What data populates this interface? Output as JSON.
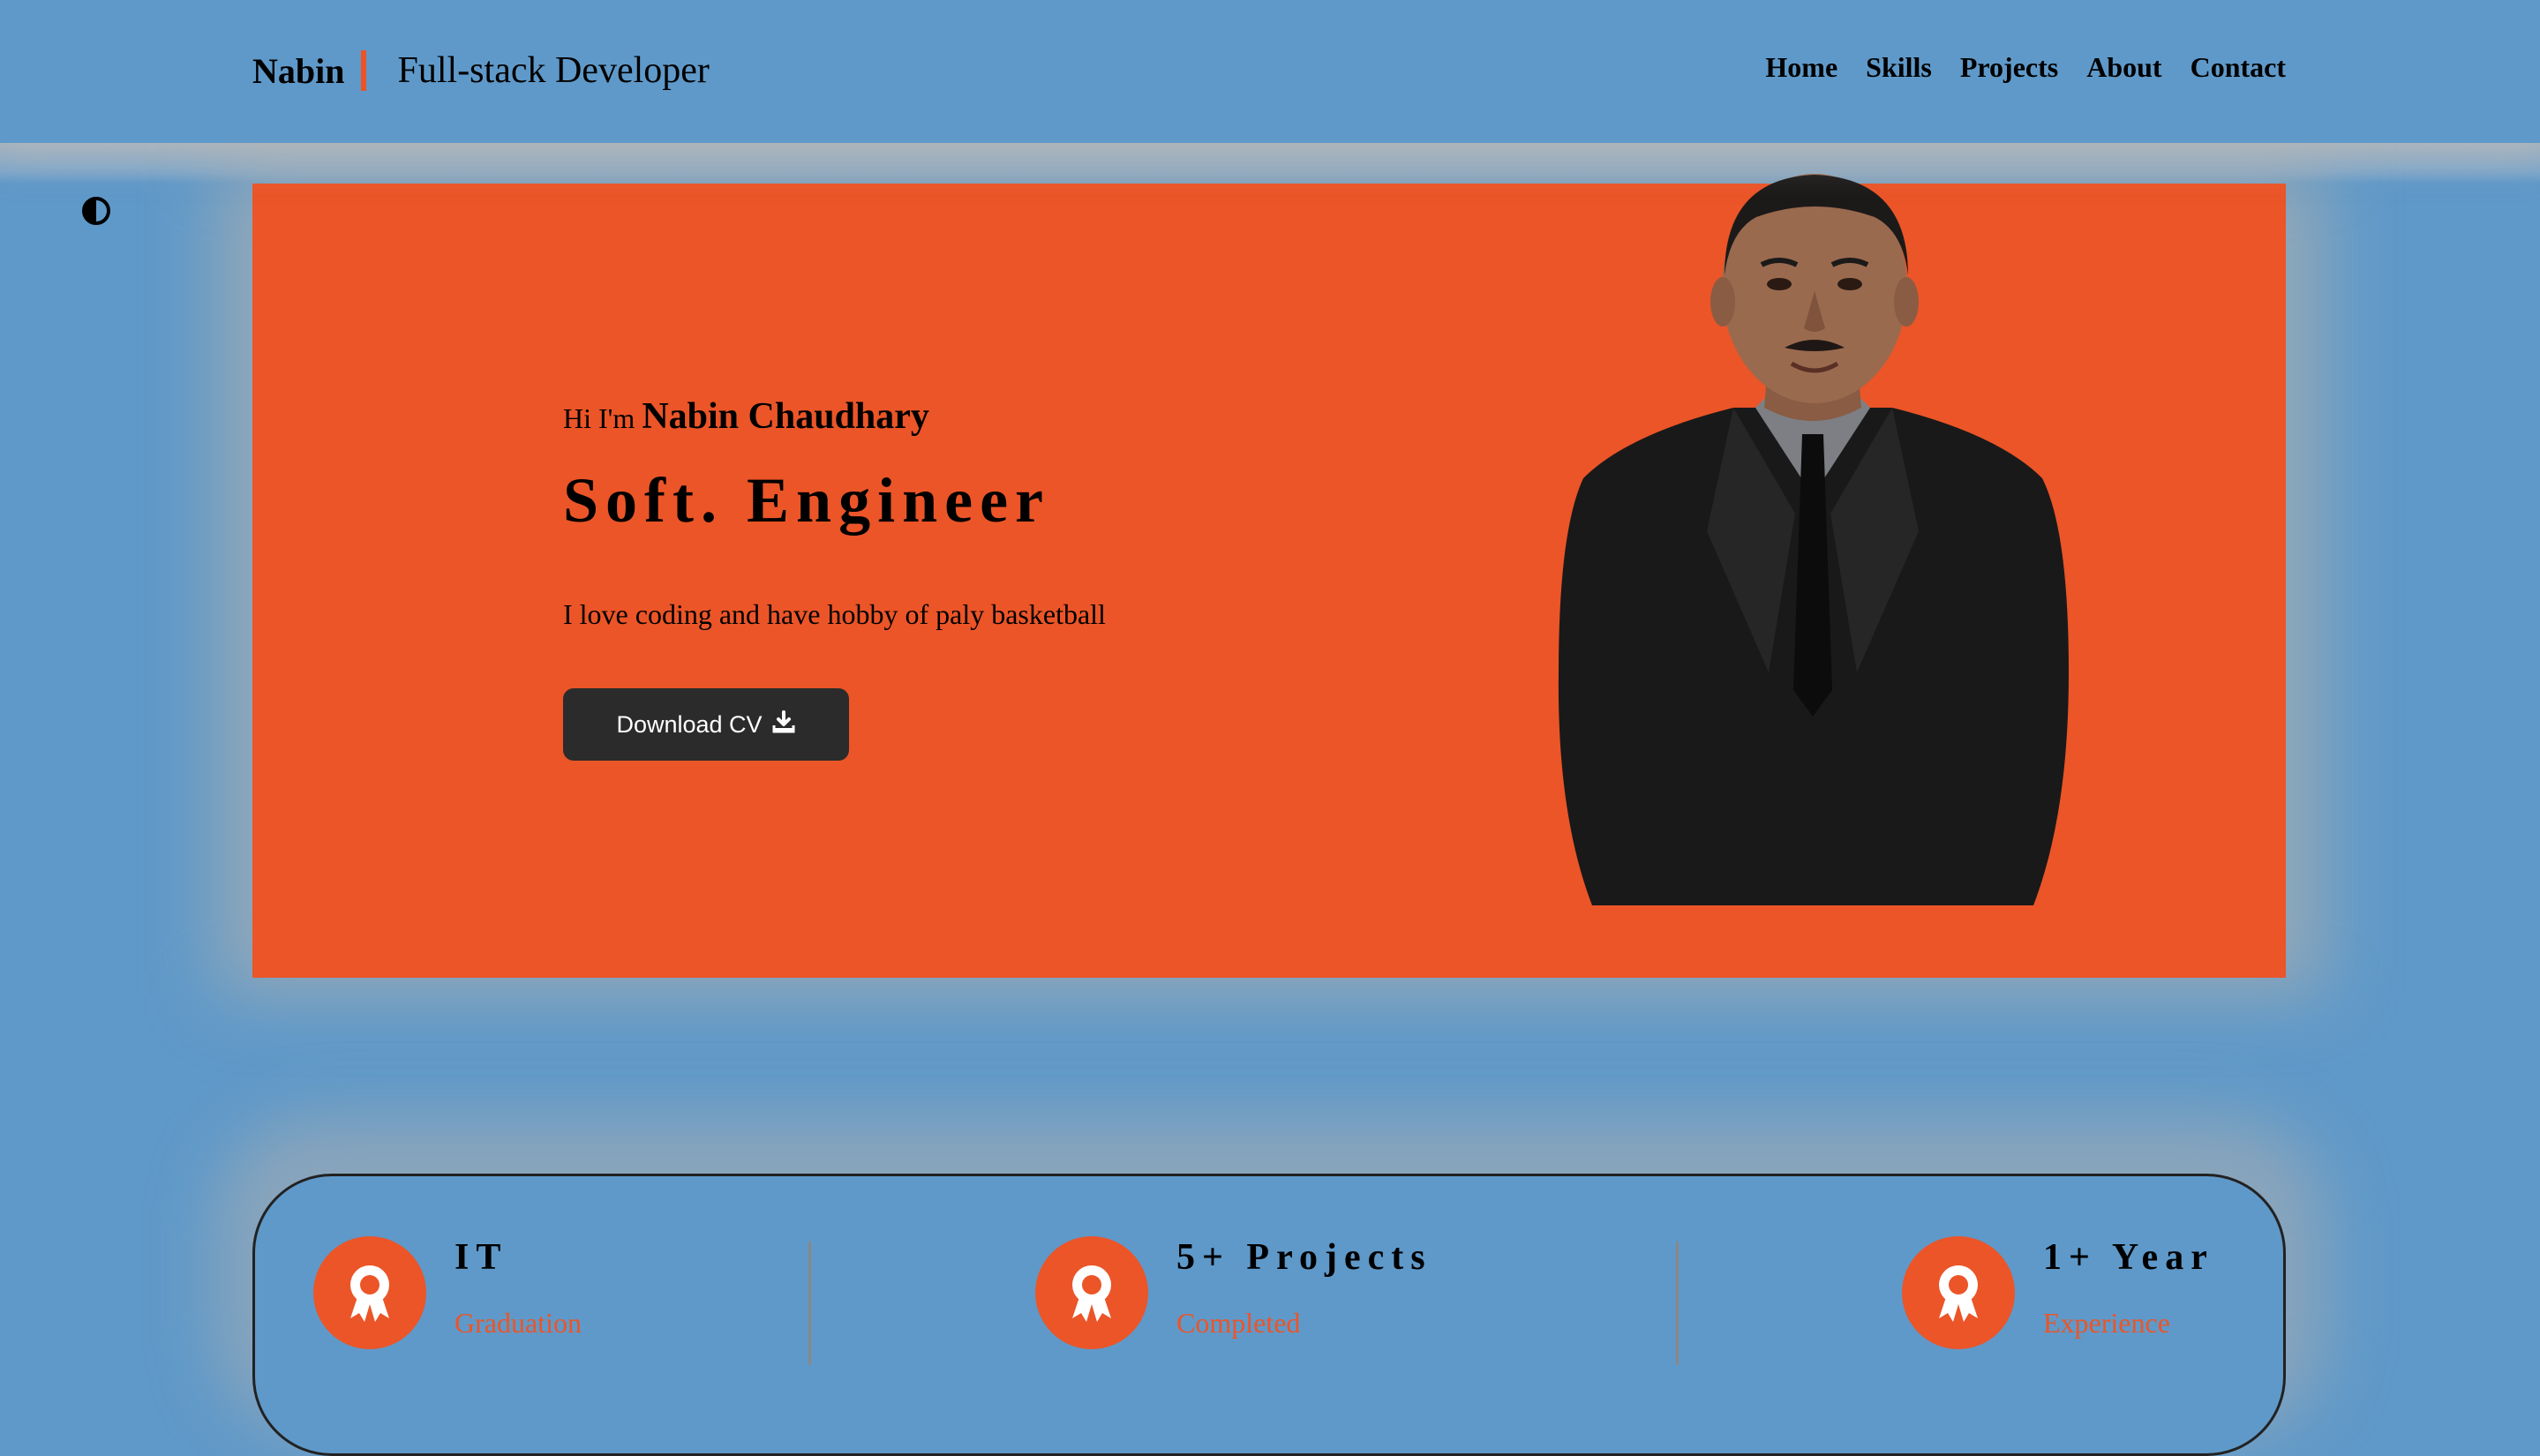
{
  "header": {
    "brand_name": "Nabin",
    "brand_title": "Full-stack Developer",
    "nav": [
      "Home",
      "Skills",
      "Projects",
      "About",
      "Contact"
    ]
  },
  "theme_toggle": {
    "icon": "half-circle-contrast-icon"
  },
  "hero": {
    "greeting": "Hi I'm",
    "name": "Nabin Chaudhary",
    "role": "Soft. Engineer",
    "tagline": "I love coding and have hobby of paly basketball",
    "cv_button": {
      "label": "Download CV",
      "icon": "download-icon"
    },
    "portrait": "profile-photo"
  },
  "stats": [
    {
      "title": "IT",
      "subtitle": "Graduation",
      "icon": "award-icon"
    },
    {
      "title": "5+ Projects",
      "subtitle": "Completed",
      "icon": "award-icon"
    },
    {
      "title": "1+ Year",
      "subtitle": "Experience",
      "icon": "award-icon"
    }
  ],
  "colors": {
    "background": "#5f99c9",
    "accent": "#eb5528",
    "button": "#2b2b2b"
  }
}
